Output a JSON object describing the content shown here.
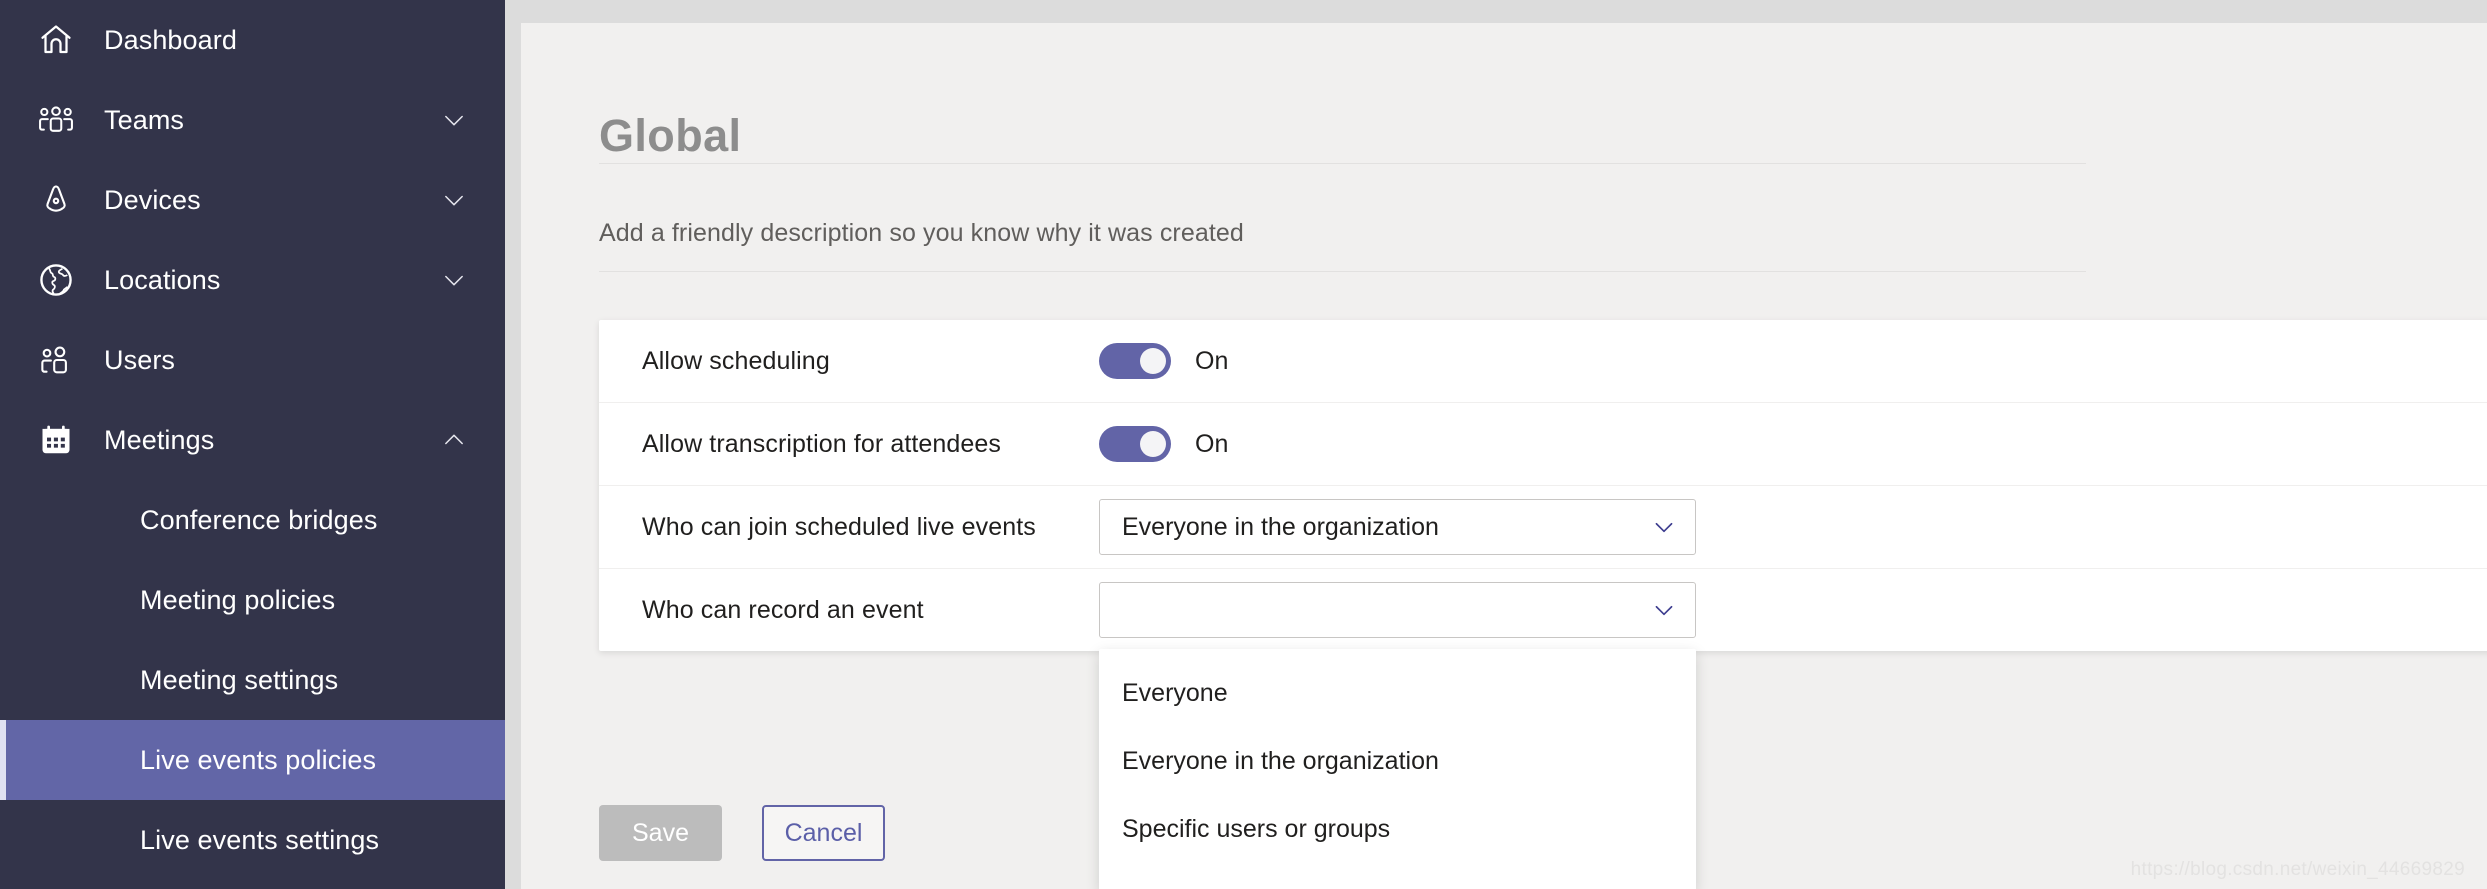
{
  "sidebar": {
    "items": [
      {
        "label": "Dashboard",
        "icon": "home-icon",
        "expandable": false,
        "chevron": ""
      },
      {
        "label": "Teams",
        "icon": "people-team-icon",
        "expandable": true,
        "chevron": "down"
      },
      {
        "label": "Devices",
        "icon": "device-icon",
        "expandable": true,
        "chevron": "down"
      },
      {
        "label": "Locations",
        "icon": "globe-icon",
        "expandable": true,
        "chevron": "down"
      },
      {
        "label": "Users",
        "icon": "people-icon",
        "expandable": false,
        "chevron": ""
      },
      {
        "label": "Meetings",
        "icon": "calendar-icon",
        "expandable": true,
        "chevron": "up"
      }
    ],
    "subitems": [
      {
        "label": "Conference bridges",
        "selected": false
      },
      {
        "label": "Meeting policies",
        "selected": false
      },
      {
        "label": "Meeting settings",
        "selected": false
      },
      {
        "label": "Live events policies",
        "selected": true
      },
      {
        "label": "Live events settings",
        "selected": false
      }
    ],
    "colors": {
      "background": "#33344a",
      "selected": "#6266a7",
      "accent_bar": "#dfe1f3"
    }
  },
  "main": {
    "title": "Global",
    "description": "Add a friendly description so you know why it was created",
    "settings": [
      {
        "label": "Allow scheduling",
        "control": "toggle",
        "value": "On"
      },
      {
        "label": "Allow transcription for attendees",
        "control": "toggle",
        "value": "On"
      },
      {
        "label": "Who can join scheduled live events",
        "control": "dropdown",
        "value": "Everyone in the organization"
      },
      {
        "label": "Who can record an event",
        "control": "dropdown",
        "value": ""
      }
    ],
    "dropdown_open": {
      "options": [
        "Everyone",
        "Everyone in the organization",
        "Specific users or groups"
      ]
    },
    "buttons": {
      "save": "Save",
      "cancel": "Cancel"
    },
    "colors": {
      "accent": "#6264a7",
      "content_background": "#f1f0ef",
      "card_background": "#ffffff",
      "title": "#8d8d8d",
      "save_disabled": "#bcbcbc"
    }
  },
  "watermark": "https://blog.csdn.net/weixin_44669829"
}
